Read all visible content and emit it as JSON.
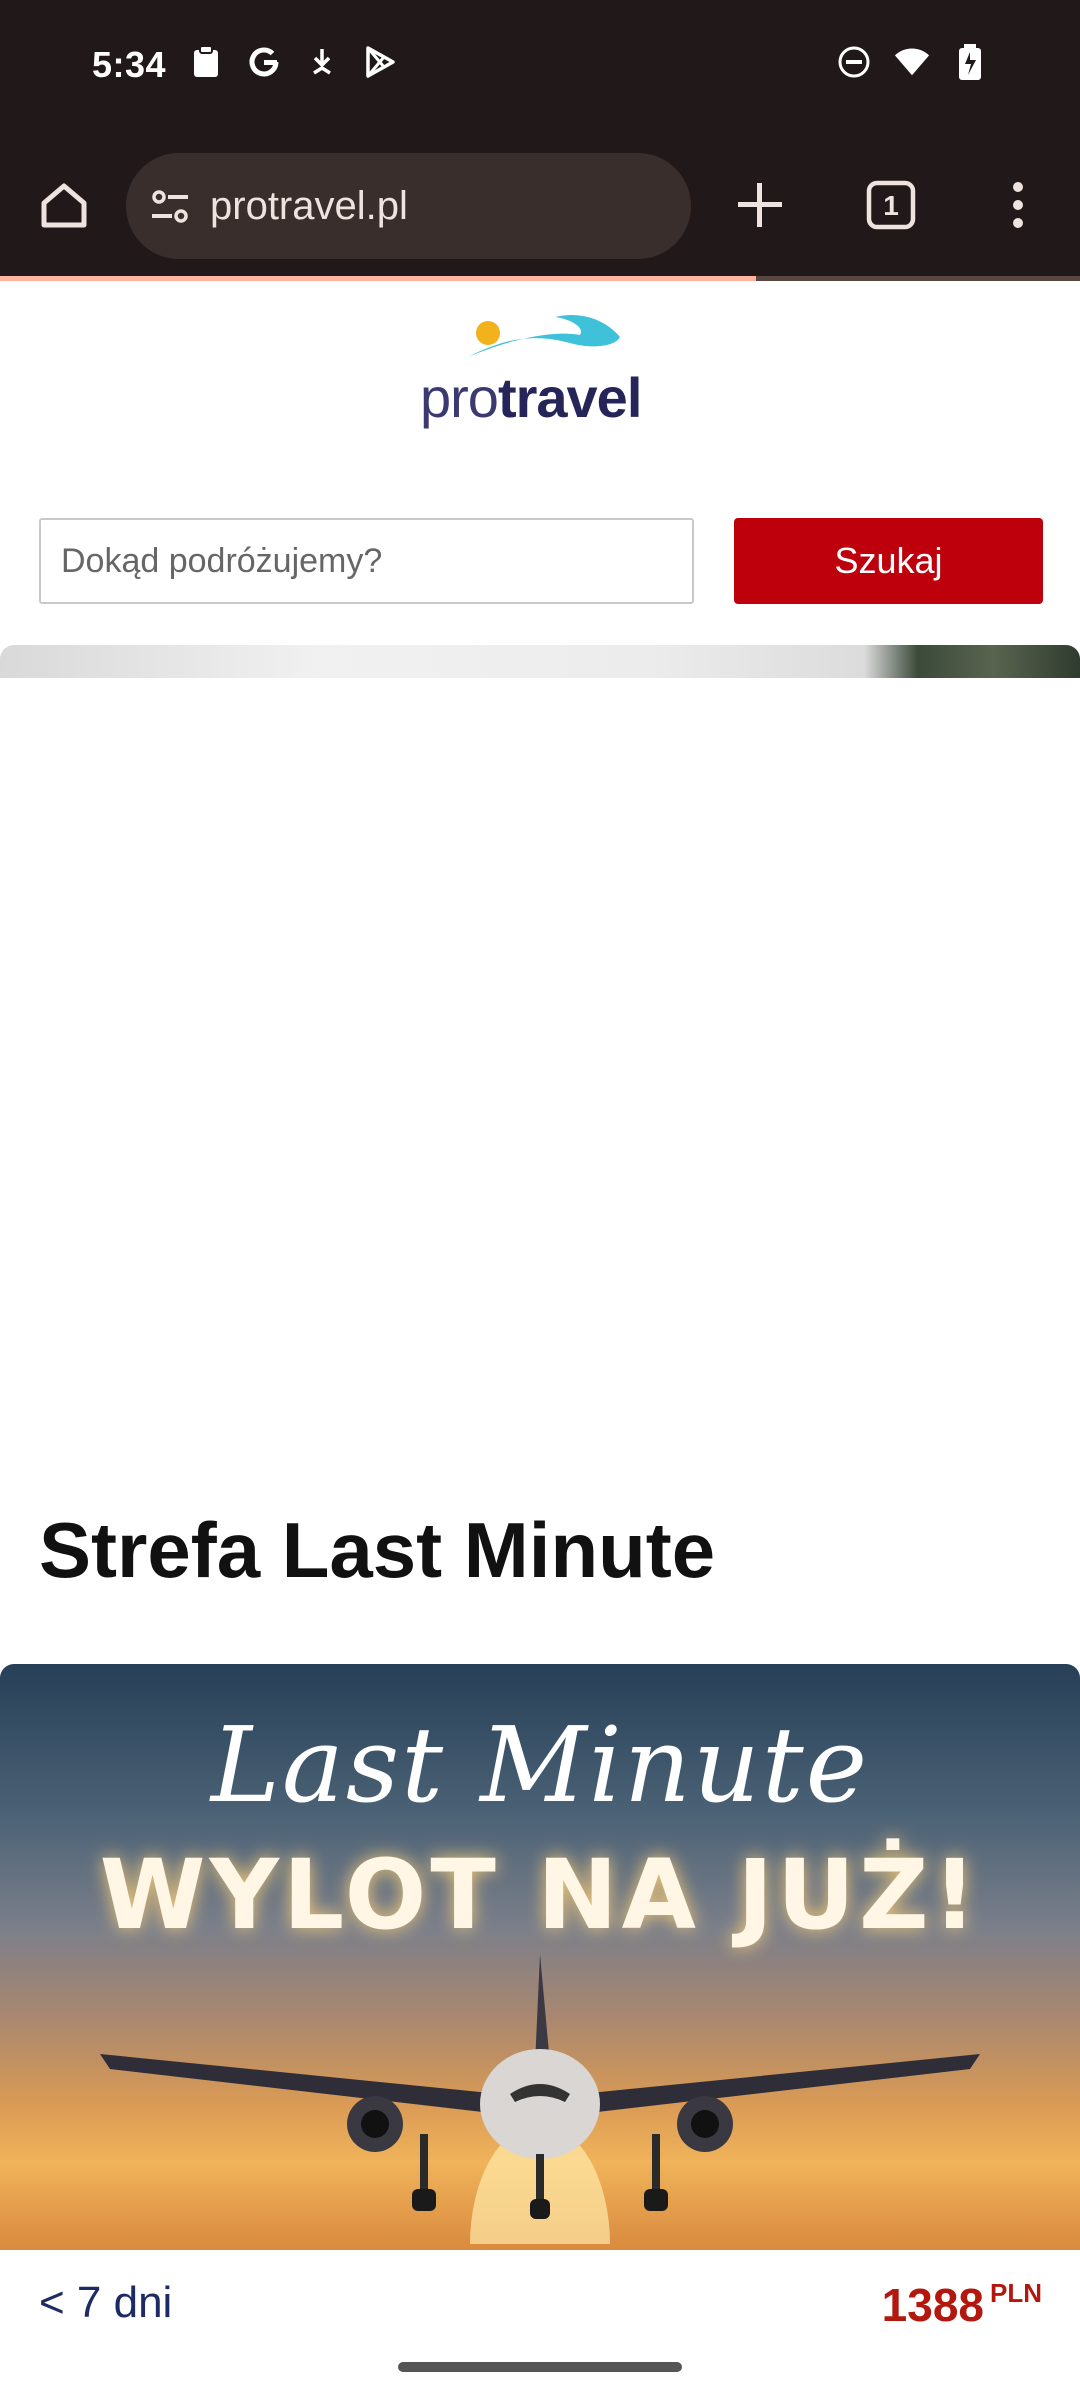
{
  "status_bar": {
    "time": "5:34",
    "left_icons": [
      "clipboard-icon",
      "google-icon",
      "download-icon",
      "play-store-icon"
    ],
    "right_icons": [
      "do-not-disturb-icon",
      "wifi-icon",
      "battery-icon"
    ]
  },
  "browser": {
    "url": "protravel.pl",
    "tab_count": "1",
    "load_progress": 0.7,
    "colors": {
      "toolbar_bg": "#211919",
      "progress": "#ffb4a2"
    }
  },
  "page": {
    "logo": {
      "part1": "pro",
      "part2": "travel"
    },
    "search": {
      "placeholder": "Dokąd podróżujemy?",
      "button_label": "Szukaj"
    },
    "section_title": "Strefa Last Minute",
    "promo": {
      "script_text": "Last Minute",
      "headline": "WYLOT NA JUŻ!"
    },
    "offer": {
      "duration": "< 7 dni",
      "price": "1388",
      "currency": "PLN"
    },
    "colors": {
      "accent_red": "#bd000c",
      "price_red": "#b3180f",
      "brand_navy": "#262559"
    }
  }
}
